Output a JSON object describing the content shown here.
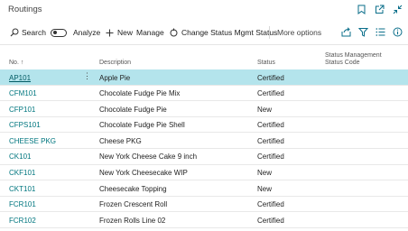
{
  "window": {
    "title": "Routings"
  },
  "titlebar_icons": [
    "bookmark-icon",
    "open-in-new-window-icon",
    "collapse-icon"
  ],
  "toolbar": {
    "search_label": "Search",
    "analyze_label": "Analyze",
    "analyze_on": false,
    "new_label": "New",
    "manage_label": "Manage",
    "change_status_label": "Change Status Mgmt Status",
    "more_options_label": "More options",
    "right_icons": [
      "share-icon",
      "filter-icon",
      "list-view-icon",
      "info-icon"
    ]
  },
  "table": {
    "columns": {
      "no": "No. ↑",
      "description": "Description",
      "status": "Status",
      "status_mgmt_line1": "Status Management",
      "status_mgmt_line2": "Status Code"
    },
    "rows": [
      {
        "no": "AP101",
        "description": "Apple Pie",
        "status": "Certified"
      },
      {
        "no": "CFM101",
        "description": "Chocolate Fudge Pie Mix",
        "status": "Certified"
      },
      {
        "no": "CFP101",
        "description": "Chocolate Fudge Pie",
        "status": "New"
      },
      {
        "no": "CFPS101",
        "description": "Chocolate Fudge Pie Shell",
        "status": "Certified"
      },
      {
        "no": "CHEESE PKG",
        "description": "Cheese PKG",
        "status": "Certified"
      },
      {
        "no": "CK101",
        "description": "New York Cheese Cake 9 inch",
        "status": "Certified"
      },
      {
        "no": "CKF101",
        "description": "New York Cheesecake WIP",
        "status": "New"
      },
      {
        "no": "CKT101",
        "description": "Cheesecake Topping",
        "status": "New"
      },
      {
        "no": "FCR101",
        "description": "Frozen Crescent Roll",
        "status": "Certified"
      },
      {
        "no": "FCR102",
        "description": "Frozen Rolls Line 02",
        "status": "Certified"
      }
    ],
    "selected_index": 0
  },
  "colors": {
    "selected_row": "#b4e4ec",
    "link": "#00767f"
  }
}
